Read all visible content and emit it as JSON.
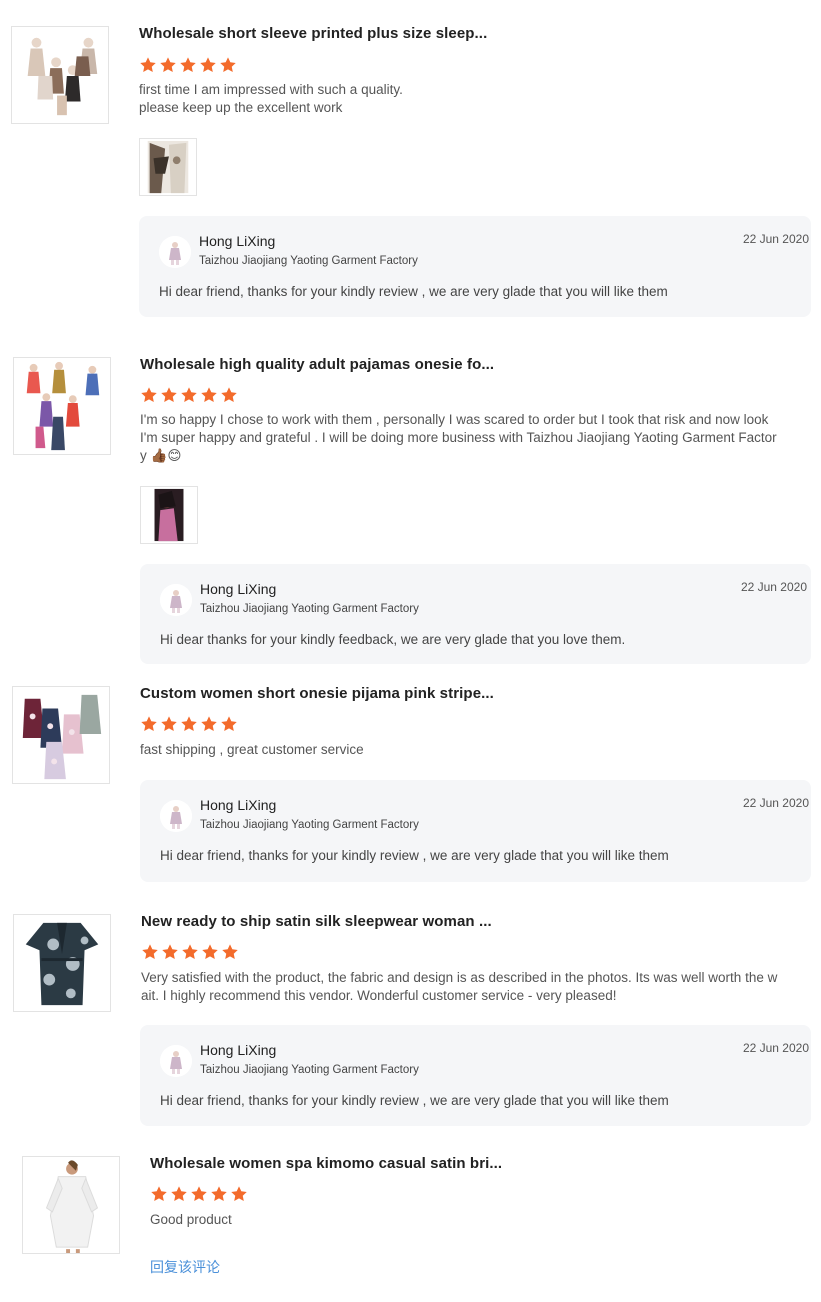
{
  "reviews": [
    {
      "title": "Wholesale short sleeve printed plus size sleep...",
      "rating": 5,
      "text": "first time I am impressed with such a quality.\nplease keep up the excellent work",
      "has_photo": true,
      "reply": {
        "name": "Hong LiXing",
        "company": "Taizhou Jiaojiang Yaoting Garment Factory",
        "date": "22 Jun 2020",
        "text": "Hi dear friend, thanks for your kindly review , we are very glade that you will like them"
      }
    },
    {
      "title": "Wholesale high quality adult pajamas onesie fo...",
      "rating": 5,
      "text": "I'm so happy I chose to work with them , personally I was scared to order but I took that risk and now look\nI'm super happy and grateful . I will be doing more business with Taizhou Jiaojiang Yaoting Garment Factor\ny",
      "emojis": "👍🏾😊",
      "has_photo": true,
      "reply": {
        "name": "Hong LiXing",
        "company": "Taizhou Jiaojiang Yaoting Garment Factory",
        "date": "22 Jun 2020",
        "text": "Hi dear thanks for your kindly feedback, we are very glade that you love them."
      }
    },
    {
      "title": "Custom women short onesie pijama pink stripe...",
      "rating": 5,
      "text": "fast shipping , great customer service",
      "has_photo": false,
      "reply": {
        "name": "Hong LiXing",
        "company": "Taizhou Jiaojiang Yaoting Garment Factory",
        "date": "22 Jun 2020",
        "text": "Hi dear friend, thanks for your kindly review , we are very glade that you will like them"
      }
    },
    {
      "title": "New ready to ship satin silk sleepwear woman ...",
      "rating": 5,
      "text": "Very satisfied with the product, the fabric and design is as described in the photos. Its was well worth the w\nait. I highly recommend this vendor. Wonderful customer service  - very pleased!",
      "has_photo": false,
      "reply": {
        "name": "Hong LiXing",
        "company": "Taizhou Jiaojiang Yaoting Garment Factory",
        "date": "22 Jun 2020",
        "text": "Hi dear friend, thanks for your kindly review , we are very glade that you will like them"
      }
    },
    {
      "title": "Wholesale women spa kimomo casual satin bri...",
      "rating": 5,
      "text": "Good product",
      "has_photo": false,
      "reply_link": "回复该评论"
    }
  ],
  "colors": {
    "star": "#f36b2b",
    "reply_bg": "#f5f6f8",
    "link": "#4a90d9"
  },
  "icons": {
    "star": "star-icon",
    "avatar": "seller-avatar"
  }
}
